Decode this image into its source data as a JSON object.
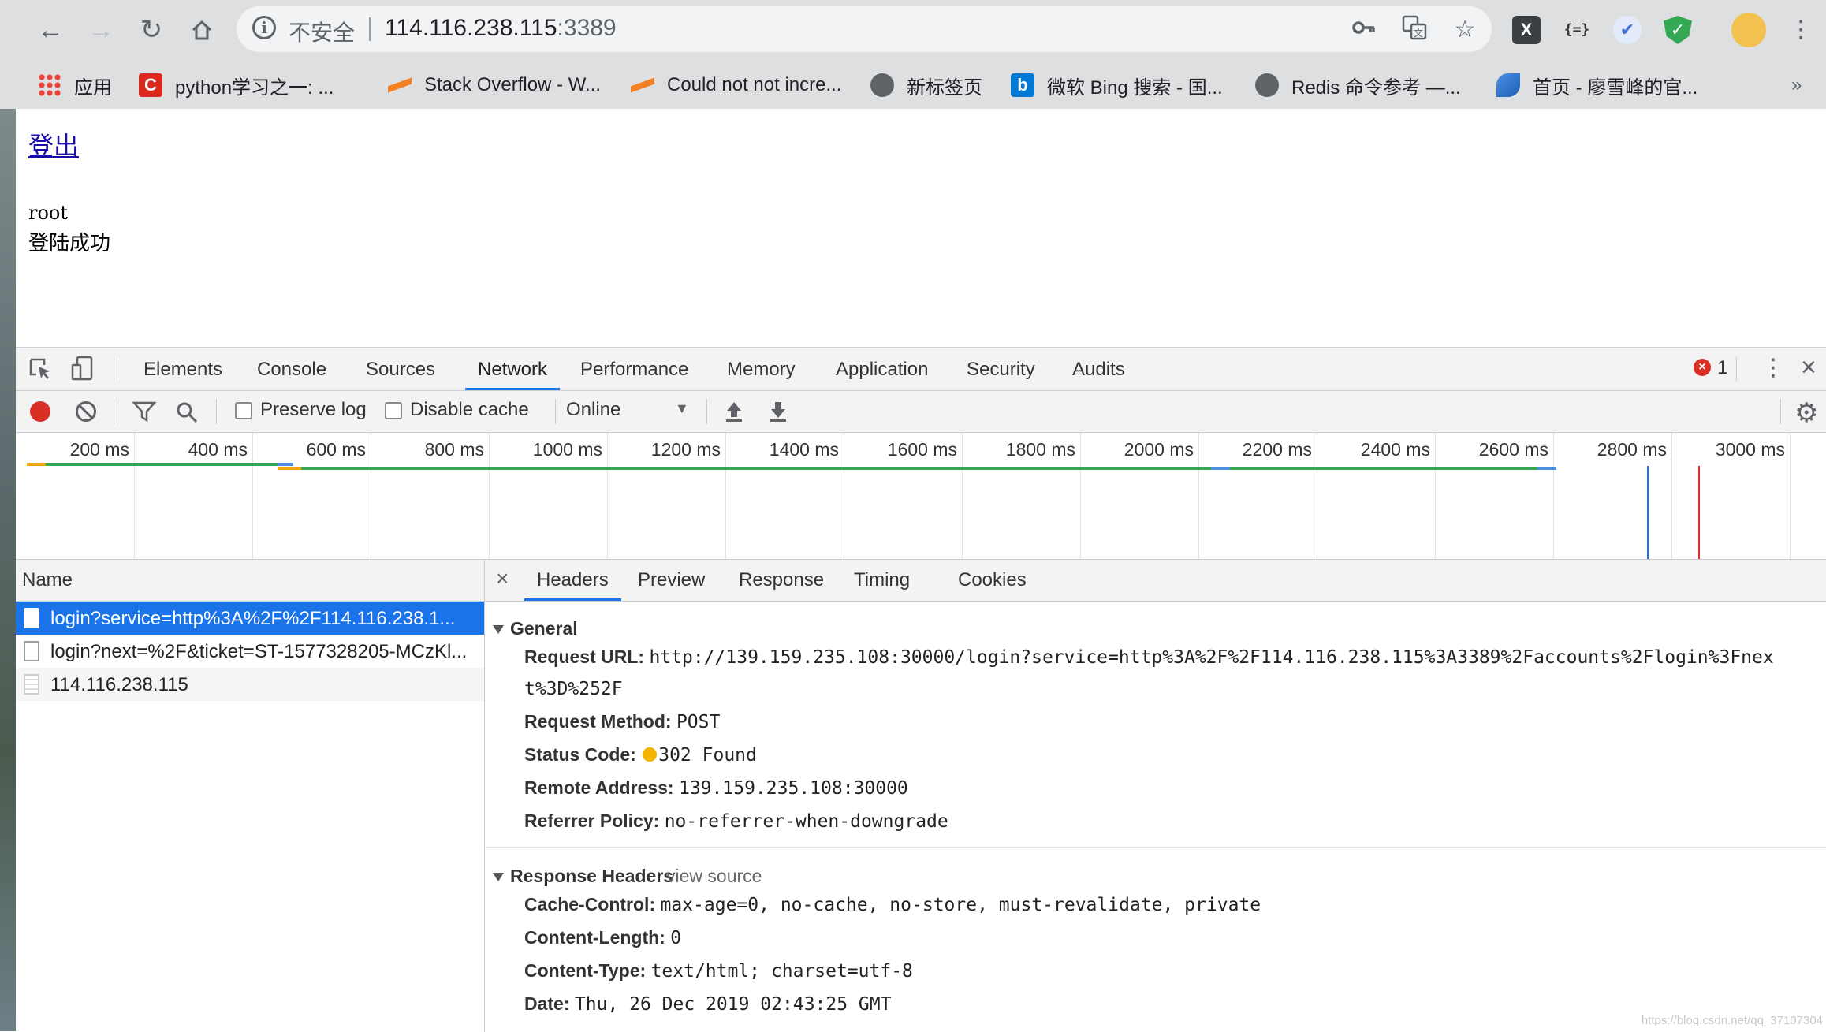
{
  "browser": {
    "omnibox": {
      "insecure_label": "不安全",
      "host": "114.116.238.115",
      "port": ":3389"
    },
    "bookmarks": [
      {
        "label": "应用"
      },
      {
        "label": "python学习之一: ..."
      },
      {
        "label": "Stack Overflow - W..."
      },
      {
        "label": "Could not not incre..."
      },
      {
        "label": "新标签页"
      },
      {
        "label": "微软 Bing 搜索 - 国..."
      },
      {
        "label": "Redis 命令参考 —..."
      },
      {
        "label": "首页 - 廖雪峰的官..."
      }
    ],
    "more_glyph": "»"
  },
  "page": {
    "logout_link": "登出",
    "user": "root",
    "message": "登陆成功"
  },
  "devtools": {
    "tabs": [
      "Elements",
      "Console",
      "Sources",
      "Network",
      "Performance",
      "Memory",
      "Application",
      "Security",
      "Audits"
    ],
    "active_tab": "Network",
    "error_count": "1",
    "toolbar": {
      "preserve_log": "Preserve log",
      "disable_cache": "Disable cache",
      "throttle": "Online"
    },
    "timeline_ticks": [
      "200 ms",
      "400 ms",
      "600 ms",
      "800 ms",
      "1000 ms",
      "1200 ms",
      "1400 ms",
      "1600 ms",
      "1800 ms",
      "2000 ms",
      "2200 ms",
      "2400 ms",
      "2600 ms",
      "2800 ms",
      "3000 ms"
    ],
    "list_header": "Name",
    "requests": [
      {
        "name": "login?service=http%3A%2F%2F114.116.238.1...",
        "selected": true
      },
      {
        "name": "login?next=%2F&ticket=ST-1577328205-MCzKl...",
        "selected": false
      },
      {
        "name": "114.116.238.115",
        "selected": false
      }
    ],
    "detail_tabs": [
      "Headers",
      "Preview",
      "Response",
      "Timing",
      "Cookies"
    ],
    "active_detail_tab": "Headers",
    "general": {
      "title": "General",
      "request_url_key": "Request URL:",
      "request_url_line1": "http://139.159.235.108:30000/login?service=http%3A%2F%2F114.116.238.115%3A3389%2Faccounts%2Flogin%3Fnex",
      "request_url_line2": "t%3D%252F",
      "method_key": "Request Method:",
      "method": "POST",
      "status_key": "Status Code:",
      "status": "302 Found",
      "status_color": "#f4b400",
      "remote_key": "Remote Address:",
      "remote": "139.159.235.108:30000",
      "referrer_key": "Referrer Policy:",
      "referrer": "no-referrer-when-downgrade"
    },
    "response_headers": {
      "title": "Response Headers",
      "view_source": "view source",
      "cache_key": "Cache-Control:",
      "cache": "max-age=0, no-cache, no-store, must-revalidate, private",
      "length_key": "Content-Length:",
      "length": "0",
      "type_key": "Content-Type:",
      "type": "text/html; charset=utf-8",
      "date_key": "Date:",
      "date": "Thu, 26 Dec 2019 02:43:25 GMT"
    }
  },
  "watermark": "https://blog.csdn.net/qq_37107304"
}
